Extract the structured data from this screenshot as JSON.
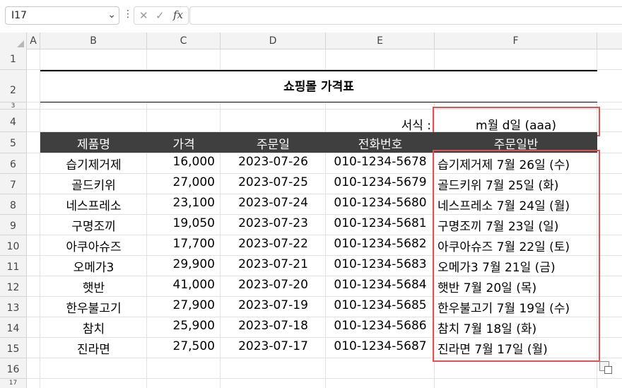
{
  "name_box": {
    "value": "I17",
    "arrow": "⌄"
  },
  "formula_bar": {
    "cancel_icon": "✕",
    "confirm_icon": "✓",
    "fx_label": "fx",
    "value": "",
    "more_icon": "⋮"
  },
  "columns": [
    "A",
    "B",
    "C",
    "D",
    "E",
    "F"
  ],
  "rows": [
    "1",
    "2",
    "3",
    "4",
    "5",
    "6",
    "7",
    "8",
    "9",
    "10",
    "11",
    "12",
    "13",
    "14",
    "15",
    "16",
    "17"
  ],
  "sheet": {
    "title": "쇼핑몰 가격표",
    "format_label": "서식 :",
    "format_value": "m월 d일 (aaa)",
    "headers": [
      "제품명",
      "가격",
      "주문일",
      "전화번호",
      "주문일반"
    ],
    "items": [
      {
        "name": "습기제거제",
        "price": "16,000",
        "date": "2023-07-26",
        "phone": "010-1234-5678",
        "formatted": "습기제거제 7월 26일 (수)"
      },
      {
        "name": "골드키위",
        "price": "27,000",
        "date": "2023-07-25",
        "phone": "010-1234-5679",
        "formatted": "골드키위 7월 25일 (화)"
      },
      {
        "name": "네스프레소",
        "price": "23,100",
        "date": "2023-07-24",
        "phone": "010-1234-5680",
        "formatted": "네스프레소 7월 24일 (월)"
      },
      {
        "name": "구명조끼",
        "price": "19,050",
        "date": "2023-07-23",
        "phone": "010-1234-5681",
        "formatted": "구명조끼 7월 23일 (일)"
      },
      {
        "name": "아쿠아슈즈",
        "price": "17,700",
        "date": "2023-07-22",
        "phone": "010-1234-5682",
        "formatted": "아쿠아슈즈 7월 22일 (토)"
      },
      {
        "name": "오메가3",
        "price": "29,900",
        "date": "2023-07-21",
        "phone": "010-1234-5683",
        "formatted": "오메가3 7월 21일 (금)"
      },
      {
        "name": "햇반",
        "price": "41,000",
        "date": "2023-07-20",
        "phone": "010-1234-5684",
        "formatted": "햇반 7월 20일 (목)"
      },
      {
        "name": "한우불고기",
        "price": "27,900",
        "date": "2023-07-19",
        "phone": "010-1234-5685",
        "formatted": "한우불고기 7월 19일 (수)"
      },
      {
        "name": "참치",
        "price": "25,900",
        "date": "2023-07-18",
        "phone": "010-1234-5686",
        "formatted": "참치 7월 18일 (화)"
      },
      {
        "name": "진라면",
        "price": "27,500",
        "date": "2023-07-17",
        "phone": "010-1234-5687",
        "formatted": "진라면 7월 17일 (월)"
      }
    ]
  },
  "colors": {
    "header_band": "#3f3f3f",
    "highlight_border": "#e05252"
  }
}
